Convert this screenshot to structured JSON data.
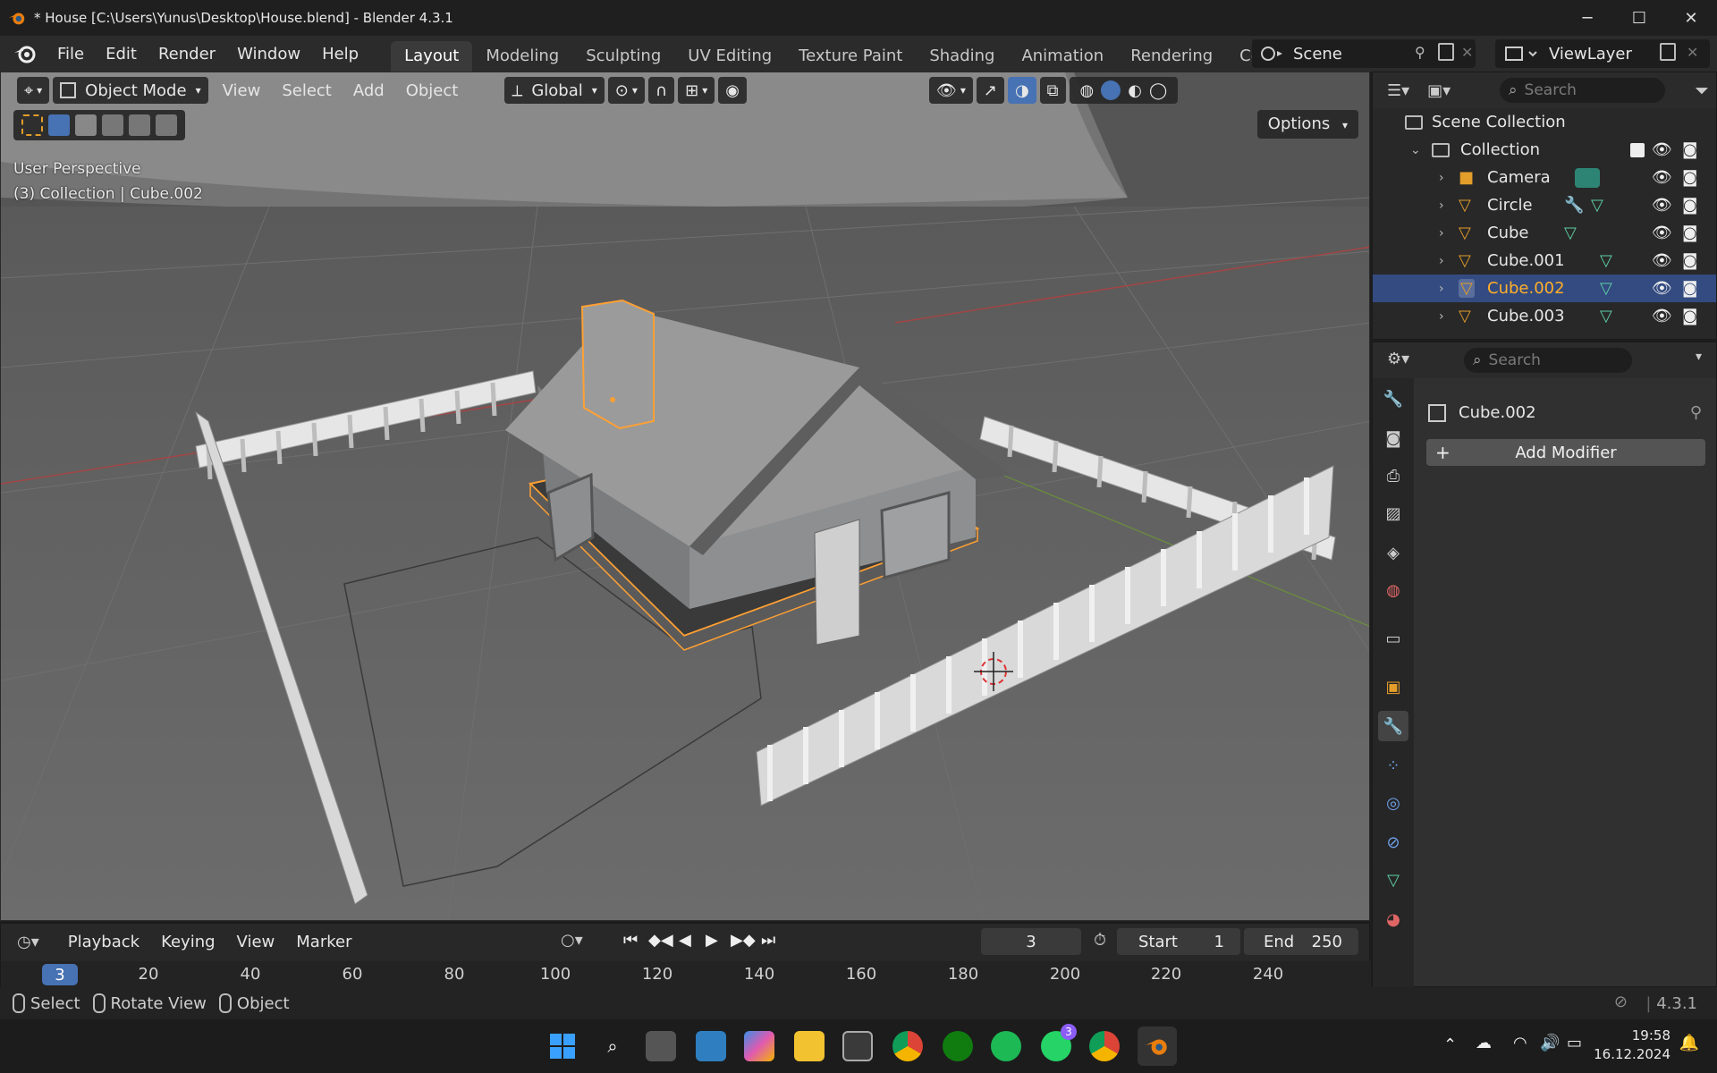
{
  "window": {
    "title": "* House [C:\\Users\\Yunus\\Desktop\\House.blend] - Blender 4.3.1",
    "controls": [
      "─",
      "☐",
      "✕"
    ]
  },
  "menubar": {
    "items": [
      "File",
      "Edit",
      "Render",
      "Window",
      "Help"
    ],
    "workspaces": [
      "Layout",
      "Modeling",
      "Sculpting",
      "UV Editing",
      "Texture Paint",
      "Shading",
      "Animation",
      "Rendering",
      "Compo"
    ],
    "active_workspace": "Layout",
    "scene": "Scene",
    "view_layer": "ViewLayer"
  },
  "viewport": {
    "mode": "Object Mode",
    "menus": [
      "View",
      "Select",
      "Add",
      "Object"
    ],
    "transform_orientation": "Global",
    "options_label": "Options",
    "info_line1": "User Perspective",
    "info_line2": "(3) Collection | Cube.002"
  },
  "outliner": {
    "search_placeholder": "Search",
    "scene_collection": "Scene Collection",
    "collection": "Collection",
    "objects": [
      {
        "name": "Camera",
        "type": "camera"
      },
      {
        "name": "Circle",
        "type": "mesh"
      },
      {
        "name": "Cube",
        "type": "mesh"
      },
      {
        "name": "Cube.001",
        "type": "mesh"
      },
      {
        "name": "Cube.002",
        "type": "mesh",
        "selected": true
      },
      {
        "name": "Cube.003",
        "type": "mesh"
      }
    ]
  },
  "properties": {
    "search_placeholder": "Search",
    "object_name": "Cube.002",
    "add_modifier_label": "Add Modifier"
  },
  "timeline": {
    "menus": [
      "Playback",
      "Keying",
      "View",
      "Marker"
    ],
    "current_frame": "3",
    "start_label": "Start",
    "start_value": "1",
    "end_label": "End",
    "end_value": "250",
    "ruler_marks": [
      "20",
      "40",
      "60",
      "80",
      "100",
      "120",
      "140",
      "160",
      "180",
      "200",
      "220",
      "240"
    ]
  },
  "statusbar": {
    "hints": [
      "Select",
      "Rotate View",
      "Object"
    ],
    "version": "4.3.1"
  },
  "taskbar": {
    "time": "19:58",
    "date": "16.12.2024",
    "whatsapp_badge": "3"
  },
  "colors": {
    "selection_highlight": "#334b80",
    "active_object_text": "#ffaf29",
    "accent_blue": "#4772b3",
    "object_outline": "#ffa033"
  }
}
